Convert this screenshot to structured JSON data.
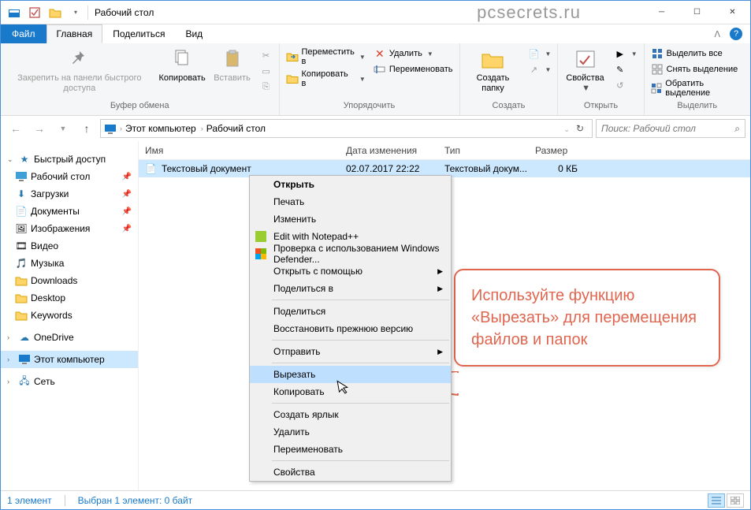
{
  "titlebar": {
    "title": "Рабочий стол",
    "watermark": "pcsecrets.ru"
  },
  "tabs": {
    "file": "Файл",
    "home": "Главная",
    "share": "Поделиться",
    "view": "Вид"
  },
  "ribbon": {
    "clipboard": {
      "pin": "Закрепить на панели быстрого доступа",
      "copy": "Копировать",
      "paste": "Вставить",
      "group": "Буфер обмена"
    },
    "organize": {
      "moveTo": "Переместить в",
      "copyTo": "Копировать в",
      "delete": "Удалить",
      "rename": "Переименовать",
      "group": "Упорядочить"
    },
    "new": {
      "newFolder": "Создать папку",
      "group": "Создать"
    },
    "open": {
      "properties": "Свойства",
      "group": "Открыть"
    },
    "select": {
      "selectAll": "Выделить все",
      "selectNone": "Снять выделение",
      "invert": "Обратить выделение",
      "group": "Выделить"
    }
  },
  "breadcrumbs": {
    "thisPC": "Этот компьютер",
    "desktop": "Рабочий стол"
  },
  "search": {
    "placeholder": "Поиск: Рабочий стол"
  },
  "nav": {
    "quickAccess": "Быстрый доступ",
    "desktop": "Рабочий стол",
    "downloads": "Загрузки",
    "documents": "Документы",
    "pictures": "Изображения",
    "videos": "Видео",
    "music": "Музыка",
    "dlFolder": "Downloads",
    "desktopFolder": "Desktop",
    "keywords": "Keywords",
    "onedrive": "OneDrive",
    "thisPC": "Этот компьютер",
    "network": "Сеть"
  },
  "columns": {
    "name": "Имя",
    "date": "Дата изменения",
    "type": "Тип",
    "size": "Размер"
  },
  "file": {
    "name": "Текстовый документ",
    "date": "02.07.2017 22:22",
    "type": "Текстовый докум...",
    "size": "0 КБ"
  },
  "context": {
    "open": "Открыть",
    "print": "Печать",
    "edit": "Изменить",
    "notepadpp": "Edit with Notepad++",
    "defender": "Проверка с использованием Windows Defender...",
    "openWith": "Открыть с помощью",
    "shareWith": "Поделиться в",
    "share": "Поделиться",
    "restore": "Восстановить прежнюю версию",
    "sendTo": "Отправить",
    "cut": "Вырезать",
    "copy": "Копировать",
    "shortcut": "Создать ярлык",
    "delete": "Удалить",
    "rename": "Переименовать",
    "properties": "Свойства"
  },
  "callout": "Используйте функцию «Вырезать» для перемещения файлов и папок",
  "status": {
    "items": "1 элемент",
    "selected": "Выбран 1 элемент: 0 байт"
  }
}
